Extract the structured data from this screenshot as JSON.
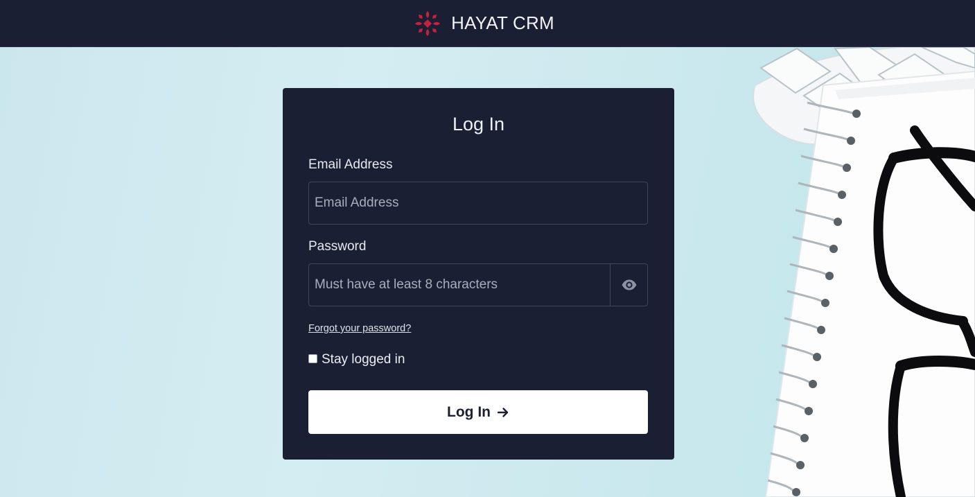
{
  "header": {
    "brand_name": "HAYAT CRM",
    "logo_icon": "flower-logo-icon",
    "logo_color": "#c8203f",
    "background": "#1a1f33"
  },
  "login_form": {
    "title": "Log In",
    "email": {
      "label": "Email Address",
      "placeholder": "Email Address",
      "value": ""
    },
    "password": {
      "label": "Password",
      "placeholder": "Must have at least 8 characters",
      "value": "",
      "toggle_icon": "eye-icon"
    },
    "forgot_password_text": "Forgot your password?",
    "stay_logged_in": {
      "label": "Stay logged in",
      "checked": false
    },
    "submit_label": "Log In",
    "submit_icon": "arrow-right-icon"
  },
  "colors": {
    "panel": "#1a1f33",
    "background": "#cfe9ee",
    "button": "#ffffff"
  }
}
